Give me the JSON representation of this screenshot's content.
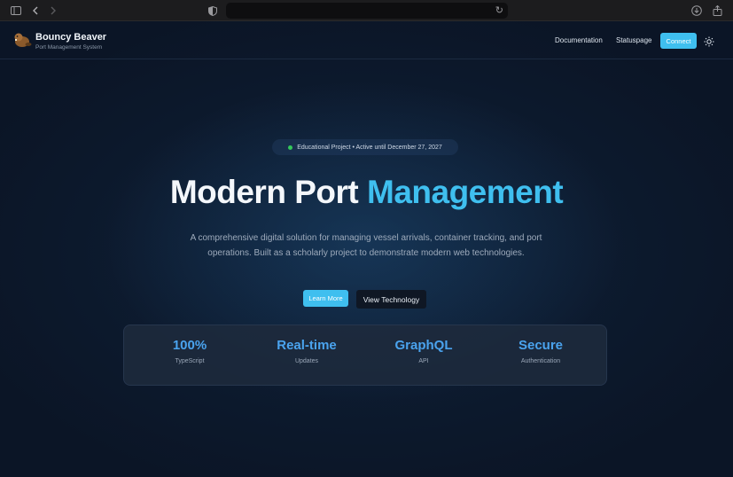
{
  "navbar": {
    "brand_name": "Bouncy Beaver",
    "brand_subtitle": "Port Management System",
    "links": [
      "Documentation",
      "Statuspage"
    ],
    "connect_label": "Connect",
    "theme_icon": "sun-icon"
  },
  "hero": {
    "badge_text": "Educational Project • Active until December 27, 2027",
    "title_main": "Modern Port ",
    "title_accent": "Management",
    "description": "A comprehensive digital solution for managing vessel arrivals, container tracking, and port operations. Built as a scholarly project to demonstrate modern web technologies.",
    "primary_button": "Learn More",
    "secondary_button": "View Technology"
  },
  "stats": [
    {
      "value": "100%",
      "label": "TypeScript"
    },
    {
      "value": "Real-time",
      "label": "Updates"
    },
    {
      "value": "GraphQL",
      "label": "API"
    },
    {
      "value": "Secure",
      "label": "Authentication"
    }
  ],
  "colors": {
    "accent": "#3fbfef",
    "stat_value": "#4aa3ee",
    "background": "#0b1526",
    "status_dot": "#34c85a"
  }
}
